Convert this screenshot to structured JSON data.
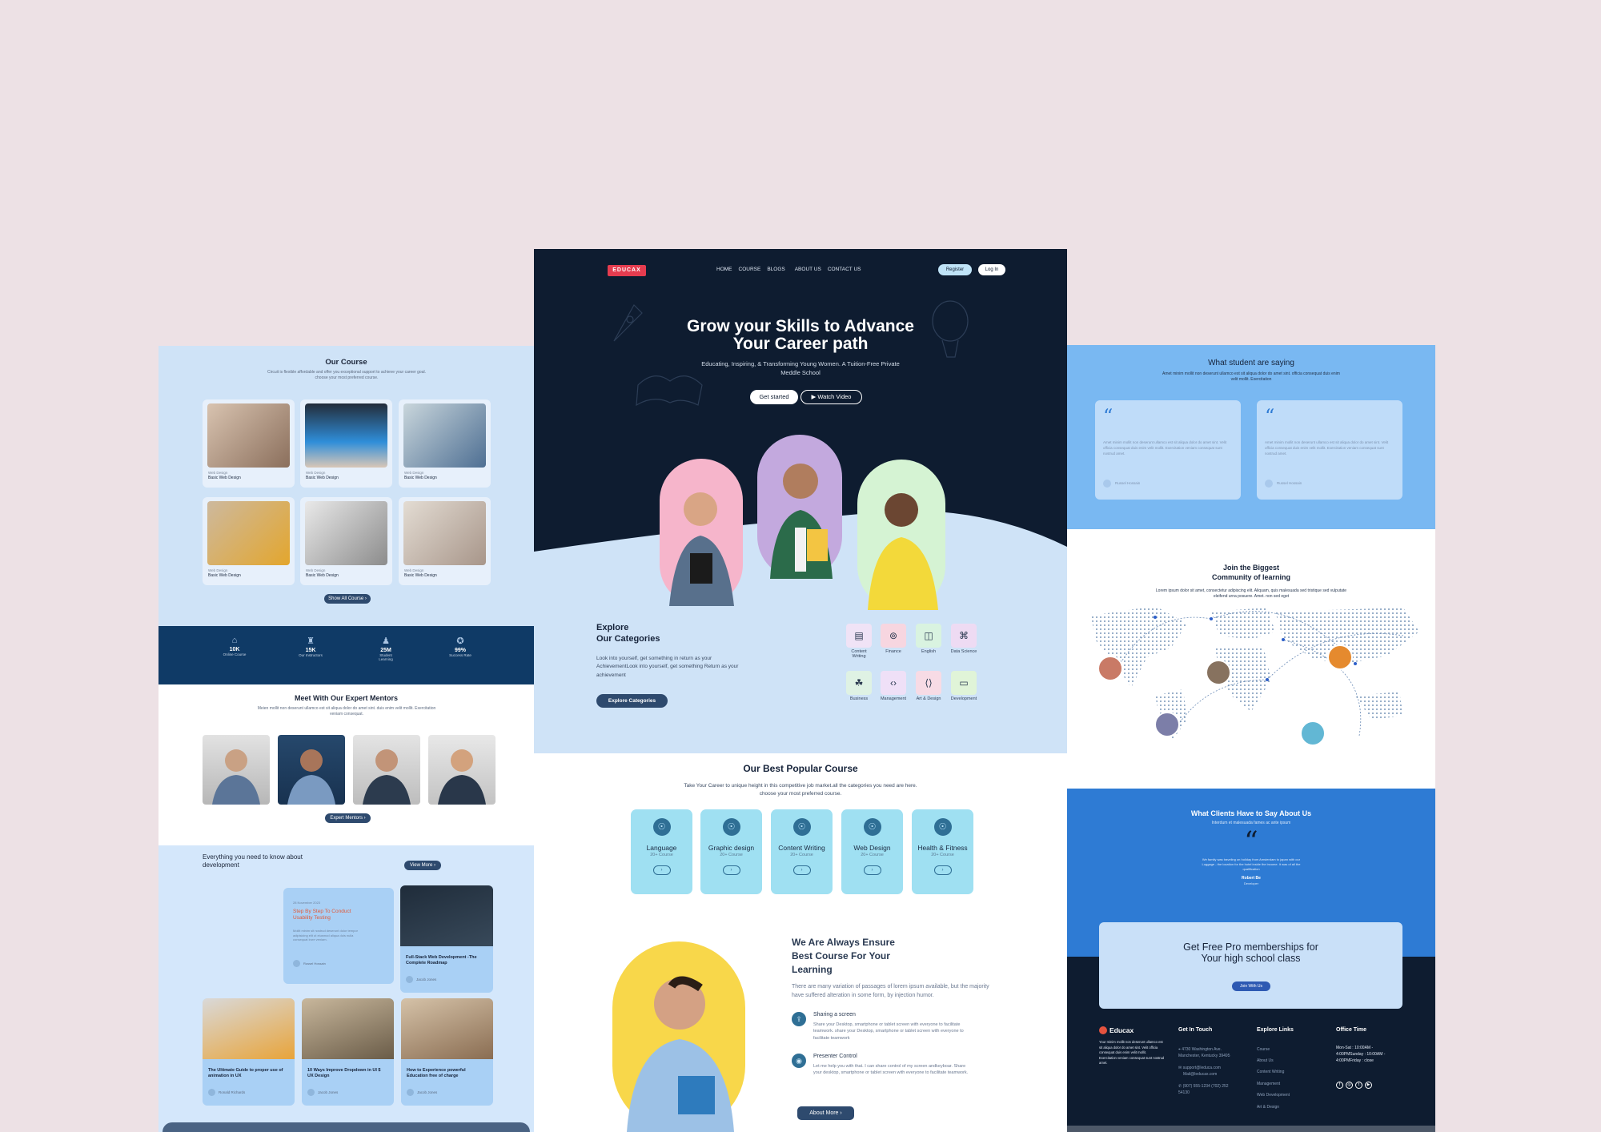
{
  "left_panel": {
    "our_course": {
      "title": "Our Course",
      "subtitle": "Circuit is flexible affordable and offer you exceptional support to achieve your career goal. choose your most preferred course.",
      "cards": [
        {
          "category": "Web Design",
          "name": "Basic Web Design"
        },
        {
          "category": "Web Design",
          "name": "Basic Web Design"
        },
        {
          "category": "Web Design",
          "name": "Basic Web Design"
        },
        {
          "category": "Web Design",
          "name": "Basic Web Design"
        },
        {
          "category": "Web Design",
          "name": "Basic Web Design"
        },
        {
          "category": "Web Design",
          "name": "Basic Web Design"
        }
      ],
      "show_all": "Show All Course"
    },
    "stats": [
      {
        "value": "10K",
        "label": "Online Course"
      },
      {
        "value": "15K",
        "label": "Our Instructors"
      },
      {
        "value": "25M",
        "label": "Student Learning"
      },
      {
        "value": "99%",
        "label": "Success Rate"
      }
    ],
    "mentors": {
      "title": "Meet With Our Expert Mentors",
      "subtitle": "Meien mollit non deserunt ullamco est sit aliqua dolor do amet sint. duis enim velit mollit. Exercitation veniam consequat.",
      "button": "Expert Mentors"
    },
    "blog": {
      "heading": "Everything you need to know about development",
      "view_more": "View More",
      "featured": {
        "date": "28 November 2023",
        "title": "Step By Step To Conduct Usability Testing",
        "excerpt": "Mollit minim sit nostrud deserunt dolor tempor adipisicing elit ut eiusmod aliqua duis nulla consequat irure veniam.",
        "author": "Russel Hossain"
      },
      "posts": [
        {
          "title": "Full-Stack Web Development -The Complete Roadmap",
          "author": "Jacob Jones"
        },
        {
          "title": "The Ultimate Guide to proper use of animation in UX",
          "author": "Ronald Richards"
        },
        {
          "title": "10 Ways Improve Dropdown in UI $ UX Design",
          "author": "Jacob Jones"
        },
        {
          "title": "How to Experience powerful Education free of charge",
          "author": "Jacob Jones"
        }
      ]
    }
  },
  "center_panel": {
    "logo": "EDUCAX",
    "nav": [
      "HOME",
      "COURSE",
      "BLOGS",
      "ABOUT US",
      "CONTACT US"
    ],
    "register": "Register",
    "login": "Log In",
    "hero": {
      "title_line1": "Grow your Skills to Advance",
      "title_line2": "Your Career path",
      "subtitle": "Educating, Inspiring, & Transforming Young Women. A Tuition-Free Private Meddle School",
      "get_started": "Get started",
      "watch_video": "Watch Video"
    },
    "explore": {
      "title_line1": "Explore",
      "title_line2": "Our Categories",
      "text": "Look into yourself, get something in return as your AchievementLook into yourself, get something Return as your achievement",
      "button": "Explore Categories",
      "categories": [
        {
          "label": "Content Writing",
          "icon": "document-icon"
        },
        {
          "label": "Finance",
          "icon": "finance-icon"
        },
        {
          "label": "English",
          "icon": "book-icon"
        },
        {
          "label": "Data Science",
          "icon": "command-icon"
        },
        {
          "label": "Business",
          "icon": "business-icon"
        },
        {
          "label": "Management",
          "icon": "code-icon"
        },
        {
          "label": "Art & Design",
          "icon": "design-icon"
        },
        {
          "label": "Development",
          "icon": "monitor-icon"
        }
      ]
    },
    "popular": {
      "title": "Our Best Popular Course",
      "subtitle": "Take Your Career to unique height in this competitive job market.all the categories you need are here. choose your most preferred course.",
      "courses": [
        {
          "name": "Language",
          "count": "20+ Course"
        },
        {
          "name": "Graphic design",
          "count": "20+ Course"
        },
        {
          "name": "Content Writing",
          "count": "20+ Course"
        },
        {
          "name": "Web Design",
          "count": "20+ Course"
        },
        {
          "name": "Health & Fitness",
          "count": "20+ Course"
        }
      ]
    },
    "ensure": {
      "title_line1": "We Are Always Ensure",
      "title_line2": "Best Course For Your",
      "title_line3": "Learning",
      "text": "There are many variation of passages of lorem ipsum available, but the majority have suffered alteration in some form, by injection humor.",
      "features": [
        {
          "title": "Sharing a screen",
          "text": "Share your Desktop, smartphone or tablet screen with everyone to facilitate teamwork. share your Desktop, smartphone or tablet screen with everyone to facilitate teamwork"
        },
        {
          "title": "Presenter Control",
          "text": "Let me help you with that. I can share control of my screen andkeyboar. Share your desktop, smartphone or tablet screen with everyone to facilitate teamwork."
        }
      ],
      "button": "About More"
    }
  },
  "right_panel": {
    "students": {
      "title": "What student are saying",
      "subtitle": "Amet minim mollit non deserunt ullamco est sit aliqua dolor do amet sint. officia consequat duis enim velit mollit. Exercitation",
      "cards": [
        {
          "text": "Amet minim mollit non deserunt ullamco est sit aliqua dolor do amet sint. Velit officia consequat duis enim velit mollit. Exercitation veniam consequat sunt nostrud amet.",
          "author": "Russel Hossain"
        },
        {
          "text": "Amet minim mollit non deserunt ullamco est sit aliqua dolor do amet sint. Velit officia consequat duis enim velit mollit. Exercitation veniam consequat sunt nostrud amet.",
          "author": "Russel Hossain"
        }
      ]
    },
    "community": {
      "title_line1": "Join the Biggest",
      "title_line2": "Community of learning",
      "text": "Lorem ipsum dolor sit amet, consectetur adipiscing elit. Aliquam, quis malesuada sed tristique sed vulputate eleifend urna posuere. Amet. non sed eget"
    },
    "clients": {
      "title": "What Clients Have to Say About Us",
      "subtitle": "Interdum et malesuada fames ac ante ipsum",
      "quote": "We family was traveling on holiday from Amsterdam to japan with our Luggage - the location for the hotel inside the income. It was of all the qualification",
      "author": "Robert Be",
      "role": "Developer"
    },
    "membership": {
      "title_line1": "Get Free Pro memberships for",
      "title_line2": "Your high school class",
      "button": "Join With Us"
    },
    "footer": {
      "brand": "Educax",
      "about": "Your minim mollit non deserunt ullamco est sit aliqua dolor do amet sint. Velit officia consequat duis enim velit mollit. Exercitation veniam consequat sunt nostrud amet.",
      "get_in_touch": {
        "title": "Get In Touch",
        "address": "4730 Washington Ave. Manchester, Kentucky 39495",
        "email1": "support@leduca.com",
        "email2": "Mail@leducax.com",
        "phone": "(907) 555-1234 (702) 252 54130"
      },
      "explore": {
        "title": "Explore Links",
        "links": [
          "Course",
          "About Us",
          "Content Writing",
          "Management",
          "Web Development",
          "Art & Design"
        ]
      },
      "office": {
        "title": "Office Time",
        "text": "Mon-Sat : 10:00AM - 4:00PMSunday : 10:00AM - 4:00PMFriday : close"
      }
    }
  },
  "colors": {
    "background": "#ede1e5",
    "navy": "#0e1c30",
    "light_blue": "#cfe3f7",
    "accent_blue": "#2e7bd4",
    "stats_blue": "#0f3a66"
  }
}
